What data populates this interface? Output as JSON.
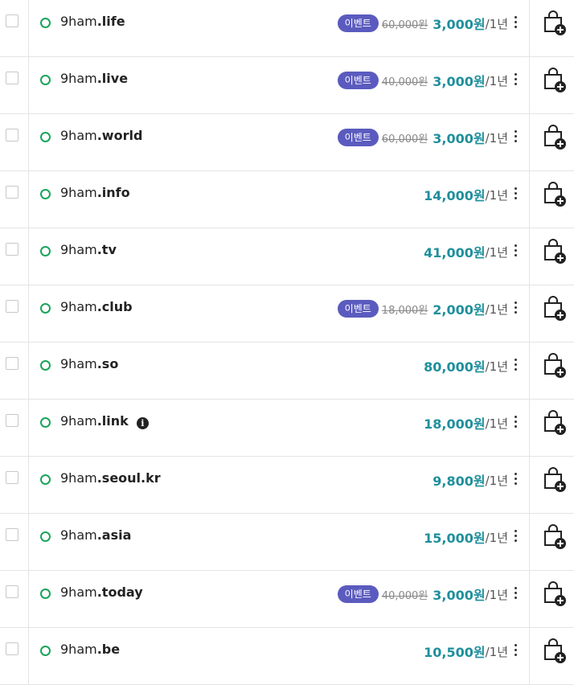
{
  "rows": [
    {
      "base": "9ham",
      "tld": ".life",
      "event": true,
      "badge": "이벤트",
      "old_price": "60,000원",
      "price": "3,000원",
      "period": "/1년",
      "info": false
    },
    {
      "base": "9ham",
      "tld": ".live",
      "event": true,
      "badge": "이벤트",
      "old_price": "40,000원",
      "price": "3,000원",
      "period": "/1년",
      "info": false
    },
    {
      "base": "9ham",
      "tld": ".world",
      "event": true,
      "badge": "이벤트",
      "old_price": "60,000원",
      "price": "3,000원",
      "period": "/1년",
      "info": false
    },
    {
      "base": "9ham",
      "tld": ".info",
      "event": false,
      "badge": "",
      "old_price": "",
      "price": "14,000원",
      "period": "/1년",
      "info": false
    },
    {
      "base": "9ham",
      "tld": ".tv",
      "event": false,
      "badge": "",
      "old_price": "",
      "price": "41,000원",
      "period": "/1년",
      "info": false
    },
    {
      "base": "9ham",
      "tld": ".club",
      "event": true,
      "badge": "이벤트",
      "old_price": "18,000원",
      "price": "2,000원",
      "period": "/1년",
      "info": false
    },
    {
      "base": "9ham",
      "tld": ".so",
      "event": false,
      "badge": "",
      "old_price": "",
      "price": "80,000원",
      "period": "/1년",
      "info": false
    },
    {
      "base": "9ham",
      "tld": ".link",
      "event": false,
      "badge": "",
      "old_price": "",
      "price": "18,000원",
      "period": "/1년",
      "info": true
    },
    {
      "base": "9ham",
      "tld": ".seoul.kr",
      "event": false,
      "badge": "",
      "old_price": "",
      "price": "9,800원",
      "period": "/1년",
      "info": false
    },
    {
      "base": "9ham",
      "tld": ".asia",
      "event": false,
      "badge": "",
      "old_price": "",
      "price": "15,000원",
      "period": "/1년",
      "info": false
    },
    {
      "base": "9ham",
      "tld": ".today",
      "event": true,
      "badge": "이벤트",
      "old_price": "40,000원",
      "price": "3,000원",
      "period": "/1년",
      "info": false
    },
    {
      "base": "9ham",
      "tld": ".be",
      "event": false,
      "badge": "",
      "old_price": "",
      "price": "10,500원",
      "period": "/1년",
      "info": false
    }
  ],
  "icons": {
    "status": "available-circle-icon",
    "cart": "cart-add-icon",
    "menu": "more-vertical-icon",
    "info": "info-icon"
  },
  "colors": {
    "accent": "#1f8f9c",
    "badge": "#5b5bbf",
    "status": "#1aa45a"
  }
}
